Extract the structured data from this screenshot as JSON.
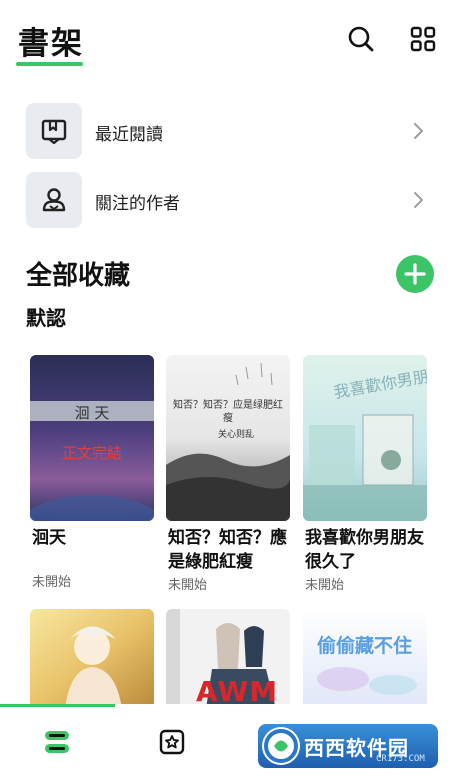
{
  "header": {
    "title": "書架",
    "icons": [
      "search-icon",
      "grid-icon"
    ]
  },
  "menu": [
    {
      "label": "最近閱讀",
      "icon": "book-icon"
    },
    {
      "label": "關注的作者",
      "icon": "author-icon"
    }
  ],
  "collection": {
    "title": "全部收藏",
    "group": "默認",
    "add_icon": "plus-icon"
  },
  "books": [
    {
      "title": "洄天",
      "status": "未開始",
      "cover_text": "洄 天",
      "cover_badge": "正文完結"
    },
    {
      "title": "知否？知否？應是綠肥紅瘦",
      "status": "未開始",
      "cover_text": "知否？知否？应是绿肥红瘦",
      "cover_author": "关心则乱"
    },
    {
      "title": "我喜歡你男朋友很久了",
      "status": "未開始"
    },
    {
      "title": "",
      "status": ""
    },
    {
      "title": "",
      "status": "",
      "cover_text": "AWM"
    },
    {
      "title": "",
      "status": "",
      "cover_text": "偷偷藏不住"
    }
  ],
  "nav": {
    "items": [
      "bookshelf-icon",
      "discover-icon",
      "library-icon",
      "profile-icon"
    ]
  },
  "watermark": {
    "text": "西西软件园",
    "sub": "CR173.COM"
  },
  "colors": {
    "accent": "#3cc567",
    "tile_bg": "#e8ebef"
  }
}
